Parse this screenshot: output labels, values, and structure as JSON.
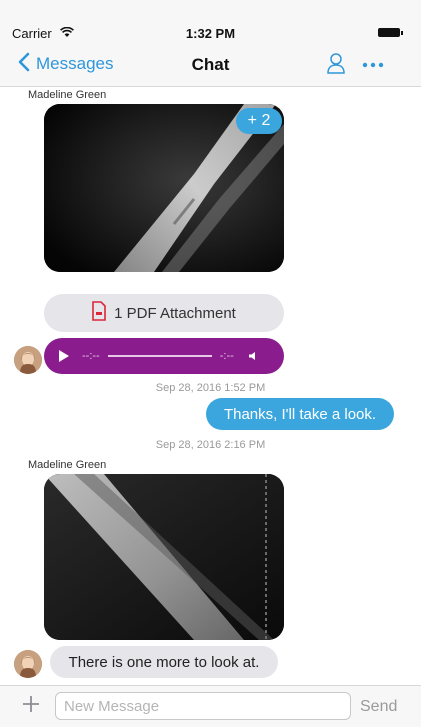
{
  "status_bar": {
    "carrier": "Carrier",
    "time": "1:32 PM"
  },
  "nav": {
    "back_label": "Messages",
    "title": "Chat"
  },
  "messages": {
    "sender_1": "Madeline Green",
    "image_badge": "+ 2",
    "pdf_label": "1 PDF Attachment",
    "audio": {
      "elapsed": "--:--",
      "remaining": "-:--"
    },
    "timestamp_1": "Sep 28, 2016 1:52 PM",
    "outgoing_1": "Thanks, I'll take a look.",
    "timestamp_2": "Sep 28, 2016 2:16 PM",
    "sender_2": "Madeline Green",
    "incoming_1": "There is one more to look at."
  },
  "composer": {
    "placeholder": "New Message",
    "send_label": "Send"
  },
  "colors": {
    "accent": "#2e97da",
    "outgoing_bubble": "#3aa6dd",
    "audio_bubble": "#8a1c8d",
    "incoming_bubble": "#e5e5ea"
  },
  "icons": [
    "wifi-icon",
    "battery-icon",
    "back-chevron-icon",
    "person-icon",
    "more-icon",
    "pdf-icon",
    "play-icon",
    "volume-icon",
    "plus-icon"
  ]
}
